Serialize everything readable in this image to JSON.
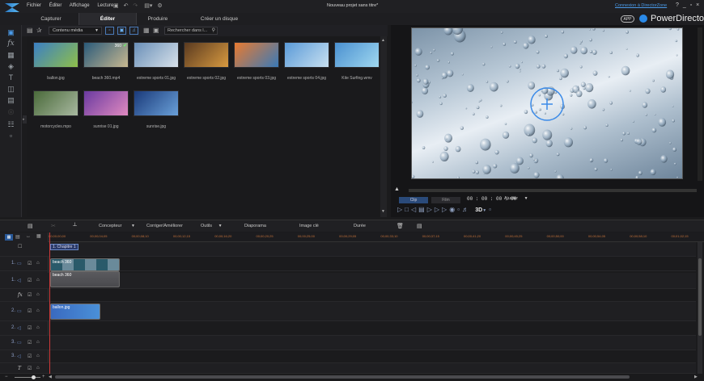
{
  "menu": [
    "Fichier",
    "Éditer",
    "Affichage",
    "Lecture"
  ],
  "window_title": "Nouveau projet sans titre*",
  "signin_link": "Connexion à DirectorZone",
  "window_controls": [
    "?",
    "_",
    "▫",
    "×"
  ],
  "app_badge": "APP",
  "brand": "PowerDirector",
  "tabs": [
    "Capturer",
    "Éditer",
    "Produire",
    "Créer un disque"
  ],
  "active_tab": "Éditer",
  "library": {
    "dropdown": "Contenu média",
    "search_placeholder": "Rechercher dans l...",
    "items": [
      {
        "label": "ballon.jpg",
        "colors": [
          "#3b7fc4",
          "#8fbf4a"
        ]
      },
      {
        "label": "beach 360.mp4",
        "colors": [
          "#2a5a7a",
          "#c8b890"
        ]
      },
      {
        "label": "extreme sports 01.jpg",
        "colors": [
          "#6a8fb8",
          "#d8e2ea"
        ]
      },
      {
        "label": "extreme sports 02.jpg",
        "colors": [
          "#5a3a20",
          "#d89a40"
        ]
      },
      {
        "label": "extreme sports 03.jpg",
        "colors": [
          "#e87a30",
          "#3a7ab8"
        ]
      },
      {
        "label": "extreme sports 04.jpg",
        "colors": [
          "#5a9ad8",
          "#c8e0f0"
        ]
      },
      {
        "label": "Kite Surfing.wmv",
        "colors": [
          "#4a90d0",
          "#a0d8f0"
        ]
      },
      {
        "label": "motorcycles.mpo",
        "colors": [
          "#4a6a3a",
          "#a8b8a0"
        ]
      },
      {
        "label": "sunrise 01.jpg",
        "colors": [
          "#6a3aa0",
          "#e08ac0"
        ]
      },
      {
        "label": "sunrise.jpg",
        "colors": [
          "#1a3a7a",
          "#6aa0d8"
        ]
      }
    ],
    "badge_360": "360"
  },
  "player": {
    "mode_clip": "Clip",
    "mode_film": "Film",
    "timecode": "00 : 00 : 00 : 00",
    "fit": "Ajuster",
    "threed": "3D"
  },
  "timeline": {
    "tools": [
      "Concepteur",
      "Corriger/Améliorer",
      "Outils",
      "Diaporama",
      "Image clé",
      "Durée"
    ],
    "chapter": "1. Chapitre 1",
    "ruler": [
      "00;00;00;00",
      "00;00;04;05",
      "00;00;08;10",
      "00;00;12;15",
      "00;00;16;20",
      "00;00;20;25",
      "00;00;25;00",
      "00;00;29;05",
      "00;00;33;10",
      "00;00;37;15",
      "00;00;41;20",
      "00;00;45;25",
      "00;00;50;00",
      "00;00;54;05",
      "00;00;58;10",
      "00;01;02;15"
    ],
    "track_labels": [
      "1.",
      "1.",
      "fx",
      "2.",
      "2.",
      "3.",
      "3.",
      "T"
    ],
    "clips": {
      "video1": "beach 360",
      "audio1": "beach 360",
      "video2": "ballon.jpg"
    }
  }
}
